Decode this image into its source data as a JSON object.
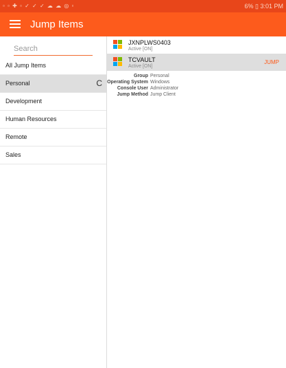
{
  "status_bar": {
    "left_icons": "▫ ▫ ✚ ▫ ✓ ✓ ✓ ☁ ☁ ◎ ▫",
    "right_text": "6% ▯ 3:01 PM"
  },
  "app_bar": {
    "title": "Jump Items"
  },
  "search": {
    "placeholder": "Search",
    "value": ""
  },
  "sidebar": {
    "items": [
      {
        "label": "All Jump Items"
      },
      {
        "label": "Personal"
      },
      {
        "label": "Development"
      },
      {
        "label": "Human Resources"
      },
      {
        "label": "Remote"
      },
      {
        "label": "Sales"
      }
    ],
    "refresh_glyph": "C"
  },
  "jump_items": [
    {
      "name": "JXNPLWS0403",
      "status": "Active [ON]"
    },
    {
      "name": "TCVAULT",
      "status": "Active [ON]",
      "action": "JUMP"
    }
  ],
  "details": [
    {
      "label": "Group",
      "value": "Personal"
    },
    {
      "label": "Operating System",
      "value": "Windows"
    },
    {
      "label": "Console User",
      "value": "Administrator"
    },
    {
      "label": "Jump Method",
      "value": "Jump Client"
    }
  ],
  "colors": {
    "accent": "#fd5b1c",
    "status_bar": "#e8461a",
    "selected_bg": "#dedede",
    "win_red": "#f25022",
    "win_green": "#7fba00",
    "win_blue": "#00a4ef",
    "win_yellow": "#ffb900"
  }
}
